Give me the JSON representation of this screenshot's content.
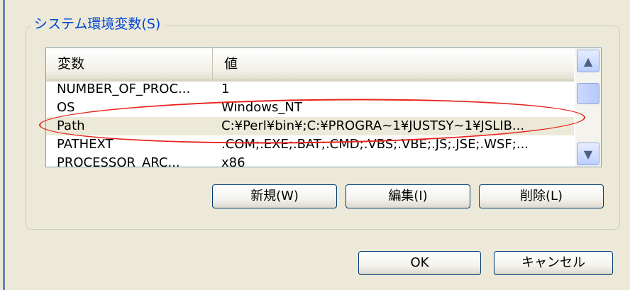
{
  "group": {
    "title": "システム環境変数(S)"
  },
  "table": {
    "headers": [
      "変数",
      "値"
    ],
    "rows": [
      {
        "name": "NUMBER_OF_PROC...",
        "value": "1"
      },
      {
        "name": "OS",
        "value": "Windows_NT"
      },
      {
        "name": "Path",
        "value": "C:¥Perl¥bin¥;C:¥PROGRA~1¥JUSTSY~1¥JSLIB..."
      },
      {
        "name": "PATHEXT",
        "value": ".COM;.EXE;.BAT;.CMD;.VBS;.VBE;.JS;.JSE;.WSF;..."
      },
      {
        "name": "PROCESSOR_ARC...",
        "value": "x86"
      }
    ]
  },
  "scrollbar": {
    "up_icon": "▲",
    "down_icon": "▼"
  },
  "buttons": {
    "new": "新規(W)",
    "edit": "編集(I)",
    "delete": "削除(L)",
    "ok": "OK",
    "cancel": "キャンセル"
  }
}
